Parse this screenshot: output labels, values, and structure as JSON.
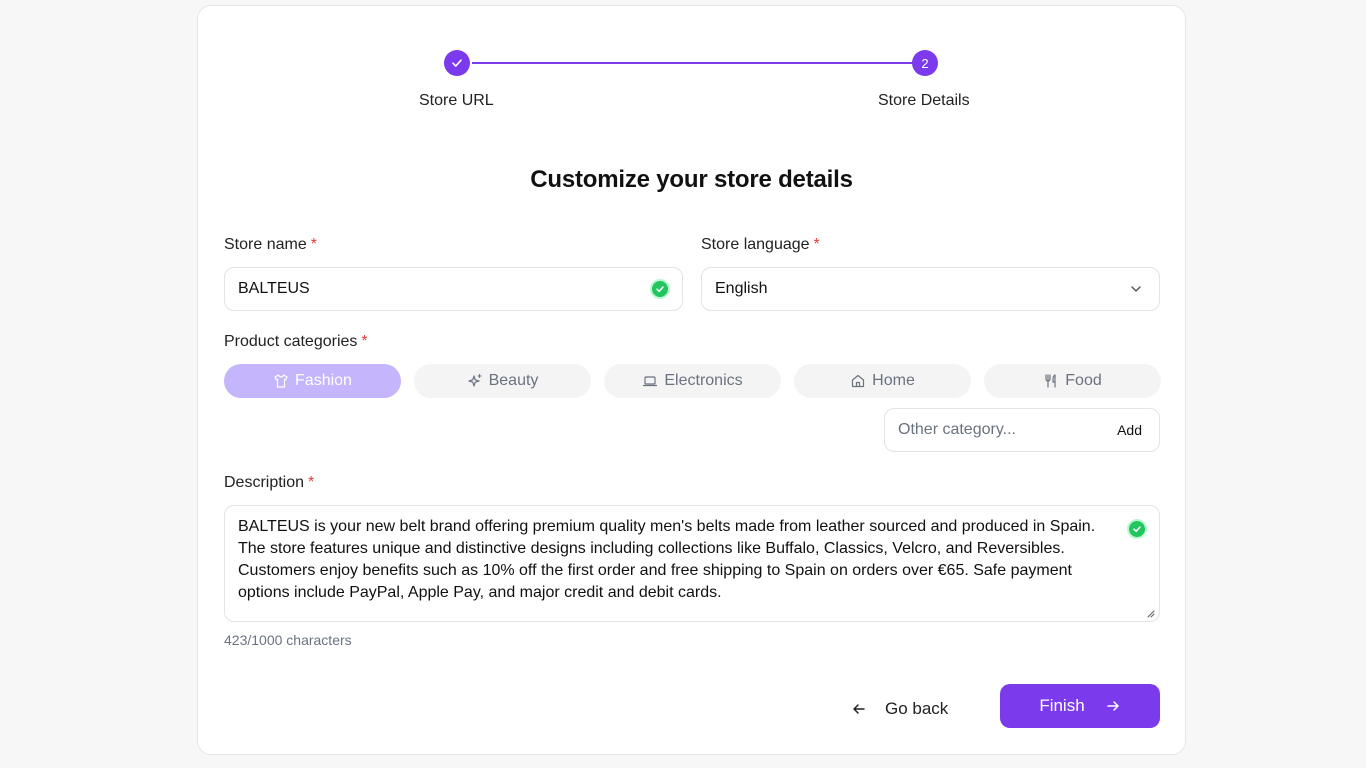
{
  "stepper": {
    "steps": [
      {
        "label": "Store URL",
        "state": "completed"
      },
      {
        "label": "Store Details",
        "number": "2",
        "state": "current"
      }
    ]
  },
  "title": "Customize your store details",
  "store_name": {
    "label": "Store name",
    "required_mark": "*",
    "value": "BALTEUS",
    "status_icon": "check-circle-icon"
  },
  "store_language": {
    "label": "Store language",
    "required_mark": "*",
    "value": "English",
    "icon": "chevron-down-icon"
  },
  "product_categories": {
    "label": "Product categories",
    "required_mark": "*",
    "items": [
      {
        "label": "Fashion",
        "icon": "shirt-icon",
        "selected": true
      },
      {
        "label": "Beauty",
        "icon": "sparkles-icon",
        "selected": false
      },
      {
        "label": "Electronics",
        "icon": "laptop-icon",
        "selected": false
      },
      {
        "label": "Home",
        "icon": "house-icon",
        "selected": false
      },
      {
        "label": "Food",
        "icon": "utensils-icon",
        "selected": false
      }
    ],
    "other_placeholder": "Other category...",
    "add_label": "Add"
  },
  "description": {
    "label": "Description",
    "required_mark": "*",
    "value": "BALTEUS is your new belt brand offering premium quality men's belts made from leather sourced and produced in Spain. The store features unique and distinctive designs including collections like Buffalo, Classics, Velcro, and Reversibles. Customers enjoy benefits such as 10% off the first order and free shipping to Spain on orders over €65. Safe payment options include PayPal, Apple Pay, and major credit and debit cards.",
    "char_count": "423/1000 characters",
    "status_icon": "check-circle-icon"
  },
  "actions": {
    "back_label": "Go back",
    "finish_label": "Finish"
  },
  "colors": {
    "accent": "#7c3aed",
    "accent_light": "#c4b5fd",
    "success": "#22c55e",
    "required": "#e53e3e"
  }
}
